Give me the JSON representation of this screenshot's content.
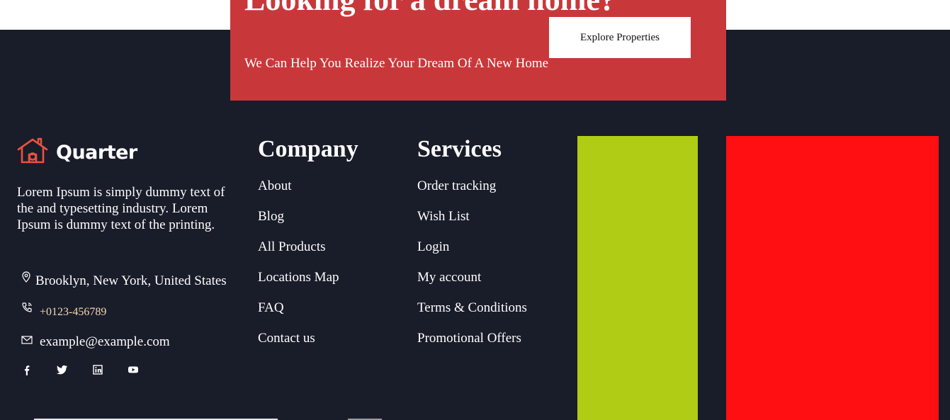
{
  "cta": {
    "title": "Looking for a dream home?",
    "subtitle": "We Can Help You Realize Your Dream Of A New Home",
    "button_label": "Explore Properties"
  },
  "brand": {
    "name": "Quarter",
    "logo_icon": "house-logo-icon",
    "accent_color": "#e8533f"
  },
  "about": {
    "text": "Lorem Ipsum is simply dummy text of the and typesetting industry. Lorem Ipsum is dummy text of the printing."
  },
  "contact": {
    "address": "Brooklyn, New York, United States",
    "phone": "+0123-456789",
    "email": "example@example.com"
  },
  "socials": [
    "facebook-icon",
    "twitter-icon",
    "linkedin-icon",
    "youtube-icon"
  ],
  "company": {
    "title": "Company",
    "links": [
      "About",
      "Blog",
      "All Products",
      "Locations Map",
      "FAQ",
      "Contact us"
    ]
  },
  "services": {
    "title": "Services",
    "links": [
      "Order tracking",
      "Wish List",
      "Login",
      "My account",
      "Terms & Conditions",
      "Promotional Offers"
    ]
  },
  "colors": {
    "footer_bg": "#191c29",
    "cta_bg": "#c8383a",
    "green_block": "#b0cc14",
    "red_block": "#ff0f12",
    "phone_text": "#f4d7b1"
  }
}
